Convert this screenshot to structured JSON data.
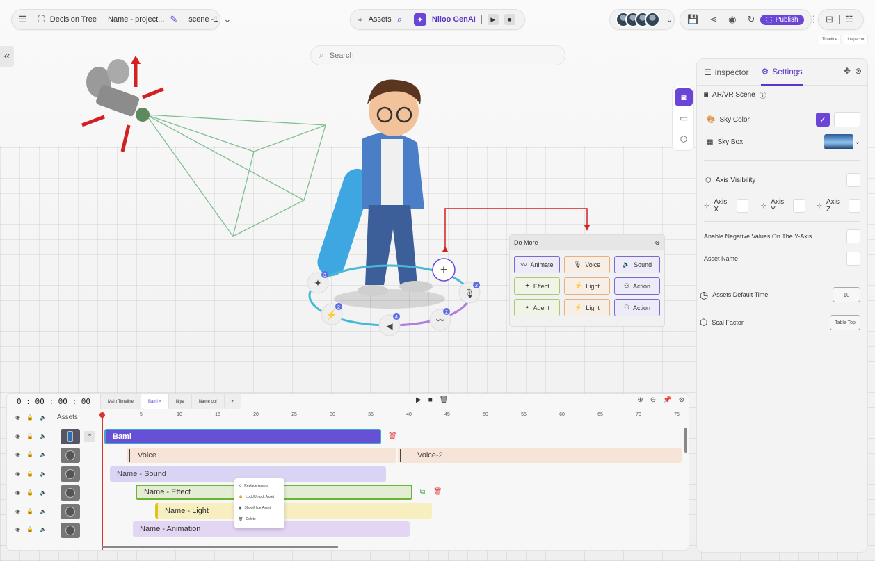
{
  "topbar": {
    "project": {
      "mode": "Decision Tree",
      "name": "Name - project...",
      "scene": "scene -1"
    },
    "assets": {
      "label": "Assets",
      "genai": "Niloo GenAI"
    },
    "publish": "Publish",
    "mini_tabs": [
      "Timeline",
      "Inspector"
    ]
  },
  "search": {
    "placeholder": "Search"
  },
  "domore": {
    "title": "Do More",
    "buttons": [
      {
        "label": "Animate",
        "kind": "purple"
      },
      {
        "label": "Voice",
        "kind": "orange"
      },
      {
        "label": "Sound",
        "kind": "purple"
      },
      {
        "label": "Effect",
        "kind": "green"
      },
      {
        "label": "Light",
        "kind": "orange"
      },
      {
        "label": "Action",
        "kind": "purple"
      },
      {
        "label": "Agent",
        "kind": "green"
      },
      {
        "label": "Light",
        "kind": "orange"
      },
      {
        "label": "Action",
        "kind": "purple"
      }
    ]
  },
  "ring_badges": [
    "3",
    "2",
    "4",
    "2",
    "2"
  ],
  "inspector": {
    "tabs": [
      "inspector",
      "Settings"
    ],
    "scene_label": "AR/VR Scene",
    "sky_color": "Sky Color",
    "sky_box": "Sky Box",
    "axis_visibility": "Axis Visibility",
    "axis_x": "Axis X",
    "axis_y": "Axis Y",
    "axis_z": "Axis Z",
    "negative_y": "Anable Negative Values On The Y-Axis",
    "asset_name": "Asset Name",
    "default_time_label": "Assets Default Time",
    "default_time_value": "10",
    "scale_label": "Scal Factor",
    "scale_value": "Table Top"
  },
  "timeline": {
    "time": "0 : 00 : 00 : 00",
    "tabs": [
      "Main Timeline",
      "Bami",
      "Niya",
      "Name obj"
    ],
    "assets_label": "Assets",
    "ticks": [
      "5",
      "10",
      "15",
      "20",
      "25",
      "30",
      "35",
      "40",
      "45",
      "50",
      "55",
      "60",
      "65",
      "70",
      "75"
    ],
    "clips": {
      "bami": "Bami",
      "voice": "Voice",
      "voice2": "Voice-2",
      "sound": "Name - Sound",
      "effect": "Name - Effect",
      "light": "Name - Light",
      "animation": "Name - Animation"
    }
  },
  "context_menu": [
    "Replace Assets",
    "Lock/Unlock Asset",
    "Show/Hide Asset",
    "Delete"
  ],
  "colors": {
    "accent": "#6b45d6",
    "playhead": "#e03131"
  }
}
